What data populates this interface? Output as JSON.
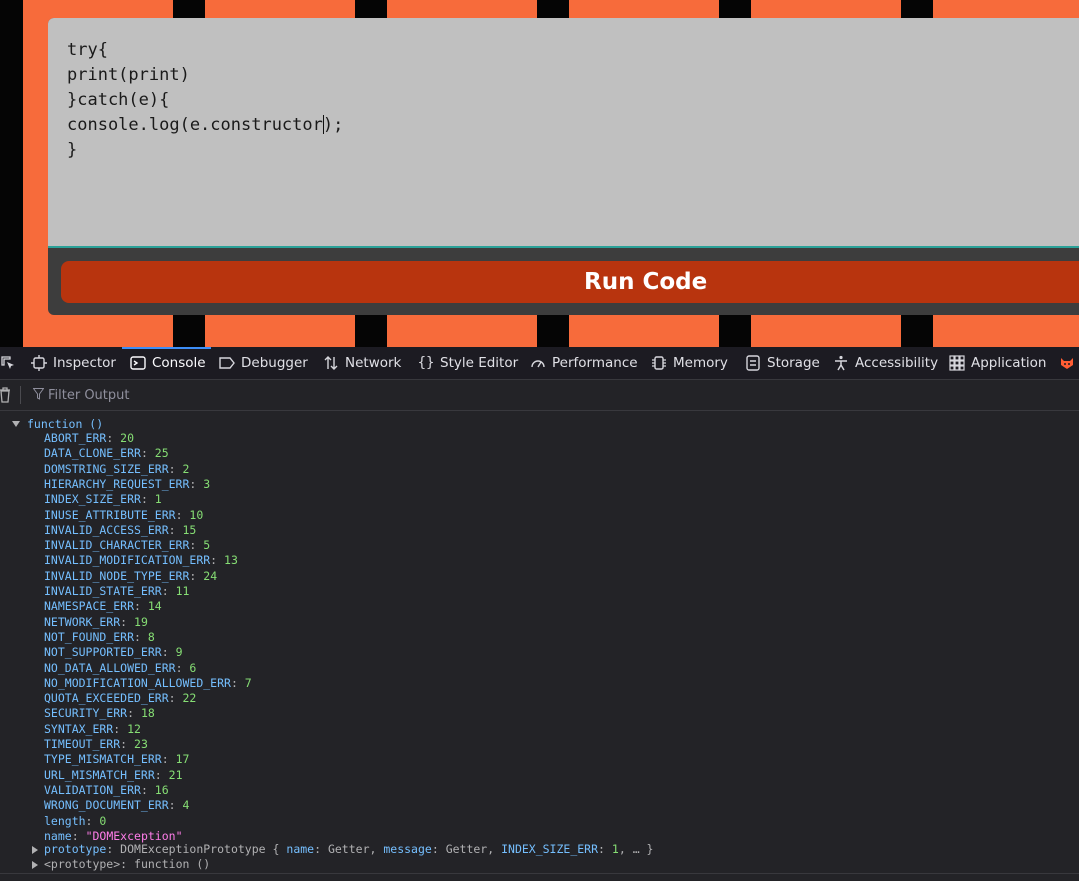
{
  "code_editor": {
    "lines": [
      "try{",
      "print(print)",
      "}catch(e){",
      "console.log(e.constructor",
      ");",
      "}"
    ]
  },
  "run_button": {
    "label": "Run Code"
  },
  "devtools": {
    "tabs": [
      {
        "label": "Inspector",
        "icon": "inspector-icon"
      },
      {
        "label": "Console",
        "icon": "console-icon",
        "active": true
      },
      {
        "label": "Debugger",
        "icon": "debugger-icon"
      },
      {
        "label": "Network",
        "icon": "network-icon"
      },
      {
        "label": "Style Editor",
        "icon": "style-editor-icon"
      },
      {
        "label": "Performance",
        "icon": "performance-icon"
      },
      {
        "label": "Memory",
        "icon": "memory-icon"
      },
      {
        "label": "Storage",
        "icon": "storage-icon"
      },
      {
        "label": "Accessibility",
        "icon": "accessibility-icon"
      },
      {
        "label": "Application",
        "icon": "application-icon"
      }
    ],
    "filter_placeholder": "Filter Output"
  },
  "console_output": {
    "head": "function ()",
    "props": [
      {
        "key": "ABORT_ERR",
        "value": "20"
      },
      {
        "key": "DATA_CLONE_ERR",
        "value": "25"
      },
      {
        "key": "DOMSTRING_SIZE_ERR",
        "value": "2"
      },
      {
        "key": "HIERARCHY_REQUEST_ERR",
        "value": "3"
      },
      {
        "key": "INDEX_SIZE_ERR",
        "value": "1"
      },
      {
        "key": "INUSE_ATTRIBUTE_ERR",
        "value": "10"
      },
      {
        "key": "INVALID_ACCESS_ERR",
        "value": "15"
      },
      {
        "key": "INVALID_CHARACTER_ERR",
        "value": "5"
      },
      {
        "key": "INVALID_MODIFICATION_ERR",
        "value": "13"
      },
      {
        "key": "INVALID_NODE_TYPE_ERR",
        "value": "24"
      },
      {
        "key": "INVALID_STATE_ERR",
        "value": "11"
      },
      {
        "key": "NAMESPACE_ERR",
        "value": "14"
      },
      {
        "key": "NETWORK_ERR",
        "value": "19"
      },
      {
        "key": "NOT_FOUND_ERR",
        "value": "8"
      },
      {
        "key": "NOT_SUPPORTED_ERR",
        "value": "9"
      },
      {
        "key": "NO_DATA_ALLOWED_ERR",
        "value": "6"
      },
      {
        "key": "NO_MODIFICATION_ALLOWED_ERR",
        "value": "7"
      },
      {
        "key": "QUOTA_EXCEEDED_ERR",
        "value": "22"
      },
      {
        "key": "SECURITY_ERR",
        "value": "18"
      },
      {
        "key": "SYNTAX_ERR",
        "value": "12"
      },
      {
        "key": "TIMEOUT_ERR",
        "value": "23"
      },
      {
        "key": "TYPE_MISMATCH_ERR",
        "value": "17"
      },
      {
        "key": "URL_MISMATCH_ERR",
        "value": "21"
      },
      {
        "key": "VALIDATION_ERR",
        "value": "16"
      },
      {
        "key": "WRONG_DOCUMENT_ERR",
        "value": "4"
      },
      {
        "key": "length",
        "value": "0"
      },
      {
        "key": "name",
        "value": "\"DOMException\"",
        "type": "string"
      }
    ],
    "prototype": {
      "key": "prototype",
      "class_name": "DOMExceptionPrototype",
      "open": "{",
      "entries": [
        {
          "key": "name",
          "value": "Getter",
          "type": "plain"
        },
        {
          "key": "message",
          "value": "Getter",
          "type": "plain"
        },
        {
          "key": "INDEX_SIZE_ERR",
          "value": "1",
          "type": "number"
        }
      ],
      "more": "… }"
    },
    "proto": {
      "key": "<prototype>",
      "value": "function ()"
    }
  }
}
